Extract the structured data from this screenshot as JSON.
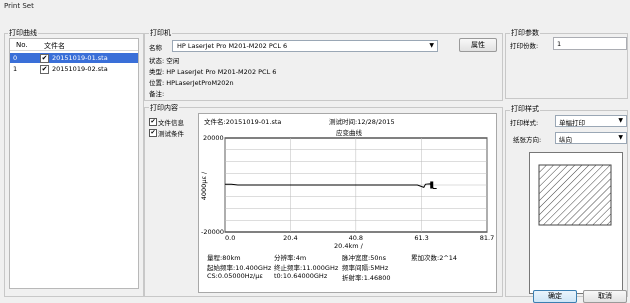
{
  "window": {
    "title": "Print Set"
  },
  "curves": {
    "group_label": "打印曲线",
    "columns": [
      "No.",
      "文件名"
    ],
    "rows": [
      {
        "no": "0",
        "checked": true,
        "name": "20151019-01.sta",
        "selected": true
      },
      {
        "no": "1",
        "checked": true,
        "name": "20151019-02.sta",
        "selected": false
      }
    ]
  },
  "printer": {
    "group_label": "打印机",
    "name_label": "名称",
    "name_value": "HP LaserJet Pro M201-M202 PCL 6",
    "properties_button": "属性",
    "status": "状态: 空闲",
    "type": "类型: HP LaserJet Pro M201-M202 PCL 6",
    "location": "位置: HPLaserJetProM202n",
    "comment": "备注:"
  },
  "content": {
    "group_label": "打印内容",
    "file_info_label": "文件信息",
    "file_info_checked": true,
    "test_cond_label": "测试条件",
    "test_cond_checked": true
  },
  "preview": {
    "filename": "文件名:20151019-01.sta",
    "time": "测试时间:12/28/2015",
    "curve_title": "应变曲线",
    "y_top": "20000",
    "y_bottom": "-20000",
    "ylabel": "4000με /",
    "x_ticks": [
      "0.0",
      "20.4",
      "40.8",
      "61.3",
      "81.7"
    ],
    "xlabel": "20.4km /",
    "params_col1": [
      "量程:80km",
      "起始频率:10.400GHz",
      "CS:0.05000Hz/με"
    ],
    "params_col2": [
      "分辨率:4m",
      "终止频率:11.000GHz",
      "t0:10.64000GHz"
    ],
    "params_col3": [
      "脉冲宽度:50ns",
      "频率间隔:5MHz",
      "折射率:1.46800"
    ],
    "params_col4": [
      "累加次数:2^14"
    ]
  },
  "chart_data": {
    "type": "line",
    "title": "应变曲线",
    "xlabel": "20.4km /",
    "ylabel": "4000με /",
    "xlim": [
      0,
      81.7
    ],
    "ylim": [
      -20000,
      20000
    ],
    "x_ticks": [
      0.0,
      20.4,
      40.8,
      61.3,
      81.7
    ],
    "series": [
      {
        "x": [
          0.0,
          2,
          4,
          60,
          62,
          62.5,
          63,
          64,
          65,
          66
        ],
        "y": [
          300,
          300,
          0,
          0,
          -1000,
          300,
          400,
          500,
          -1500,
          -1500
        ]
      }
    ]
  },
  "params": {
    "group_label": "打印参数",
    "copies_label": "打印份数:",
    "copies_value": "1"
  },
  "style": {
    "group_label": "打印样式",
    "style_label": "打印样式:",
    "style_value": "单幅打印",
    "orient_label": "纸张方向:",
    "orient_value": "纵向"
  },
  "footer": {
    "ok": "确定",
    "cancel": "取消"
  }
}
